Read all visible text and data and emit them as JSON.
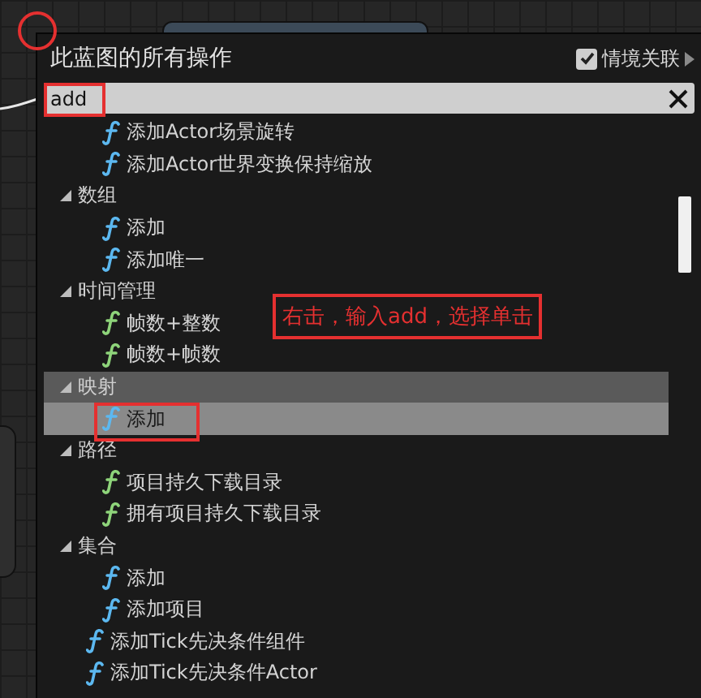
{
  "menu": {
    "title": "此蓝图的所有操作",
    "context_sensitive": {
      "label": "情境关联",
      "checked": true
    },
    "search": {
      "value": "add"
    }
  },
  "entries": [
    {
      "kind": "group",
      "children": [
        {
          "kind": "function",
          "label": "添加Actor场景旋转",
          "color": "#5cb8f0",
          "selected": false
        },
        {
          "kind": "function",
          "label": "添加Actor世界变换保持缩放",
          "color": "#5cb8f0",
          "selected": false
        }
      ]
    },
    {
      "kind": "category",
      "label": "数组",
      "expanded": true,
      "children": [
        {
          "kind": "function",
          "label": "添加",
          "color": "#5cb8f0",
          "selected": false
        },
        {
          "kind": "function",
          "label": "添加唯一",
          "color": "#5cb8f0",
          "selected": false
        }
      ]
    },
    {
      "kind": "category",
      "label": "时间管理",
      "expanded": true,
      "children": [
        {
          "kind": "function",
          "label": "帧数+整数",
          "color": "#8ed47a",
          "selected": false
        },
        {
          "kind": "function",
          "label": "帧数+帧数",
          "color": "#8ed47a",
          "selected": false
        }
      ]
    },
    {
      "kind": "category",
      "label": "映射",
      "expanded": true,
      "children": [
        {
          "kind": "function",
          "label": "添加",
          "color": "#5cb8f0",
          "selected": true
        }
      ]
    },
    {
      "kind": "category",
      "label": "路径",
      "expanded": true,
      "children": [
        {
          "kind": "function",
          "label": "项目持久下载目录",
          "color": "#8ed47a",
          "selected": false
        },
        {
          "kind": "function",
          "label": "拥有项目持久下载目录",
          "color": "#8ed47a",
          "selected": false
        }
      ]
    },
    {
      "kind": "category",
      "label": "集合",
      "expanded": true,
      "children": [
        {
          "kind": "function",
          "label": "添加",
          "color": "#5cb8f0",
          "selected": false
        },
        {
          "kind": "function",
          "label": "添加项目",
          "color": "#5cb8f0",
          "selected": false
        }
      ]
    },
    {
      "kind": "function",
      "label": "添加Tick先决条件组件",
      "color": "#5cb8f0",
      "selected": false
    },
    {
      "kind": "function",
      "label": "添加Tick先决条件Actor",
      "color": "#5cb8f0",
      "selected": false
    }
  ],
  "annotation": {
    "note": "右击，输入add，选择单击"
  }
}
